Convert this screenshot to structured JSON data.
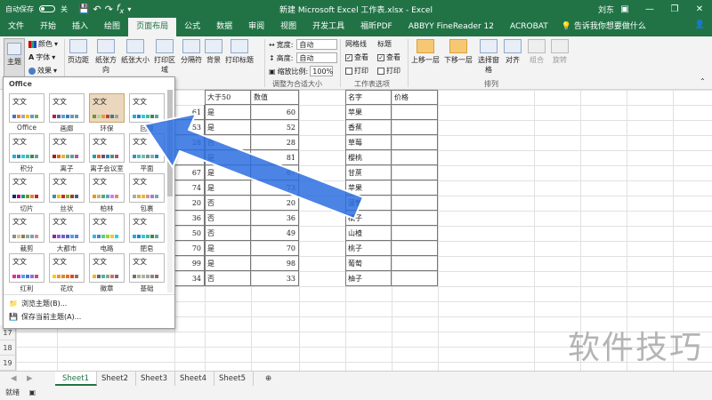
{
  "titlebar": {
    "autosave": "自动保存",
    "autosave_state": "关",
    "title": "新建 Microsoft Excel 工作表.xlsx  -  Excel",
    "user": "刘东"
  },
  "tabs": [
    "文件",
    "开始",
    "插入",
    "绘图",
    "页面布局",
    "公式",
    "数据",
    "审阅",
    "视图",
    "开发工具",
    "福昕PDF",
    "ABBYY FineReader 12",
    "ACROBAT"
  ],
  "active_tab": 4,
  "tell": "告诉我你想要做什么",
  "ribbon": {
    "theme": "主题",
    "colors": "颜色",
    "fonts": "字体",
    "effects": "效果",
    "margins": "页边距",
    "orientation": "纸张方向",
    "size": "纸张大小",
    "print_area": "打印区域",
    "breaks": "分隔符",
    "background": "背景",
    "print_titles": "打印标题",
    "width_label": "宽度:",
    "width_value": "自动",
    "height_label": "高度:",
    "height_value": "自动",
    "scale_label": "缩放比例:",
    "scale_value": "100%",
    "fit_group": "调整为合适大小",
    "gridlines": "网格线",
    "headings": "标题",
    "view": "查看",
    "print": "打印",
    "sheet_options": "工作表选项",
    "bring_forward": "上移一层",
    "send_backward": "下移一层",
    "selection_pane": "选择窗格",
    "align": "对齐",
    "group": "组合",
    "rotate": "旋转",
    "arrange": "排列"
  },
  "gallery": {
    "header": "Office",
    "themes": [
      {
        "name": "Office",
        "sample": "文文",
        "colors": [
          "#4472c4",
          "#ed7d31",
          "#a5a5a5",
          "#ffc000",
          "#5b9bd5",
          "#70ad47"
        ]
      },
      {
        "name": "画廊",
        "sample": "文文",
        "colors": [
          "#b71e42",
          "#4a66ac",
          "#629dd1",
          "#297fd5",
          "#7f8fa9",
          "#5aa2ae"
        ]
      },
      {
        "name": "环保",
        "sample": "文文",
        "colors": [
          "#6a9a1f",
          "#b5d58b",
          "#e29d3e",
          "#c03d3e",
          "#3c7c8c",
          "#a0a0a0"
        ]
      },
      {
        "name": "回顾",
        "sample": "文文",
        "colors": [
          "#1cade4",
          "#2683c6",
          "#27ced7",
          "#42ba97",
          "#3e8853",
          "#62a39f"
        ]
      },
      {
        "name": "积分",
        "sample": "文文",
        "colors": [
          "#1cade4",
          "#2683c6",
          "#27ced7",
          "#42ba97",
          "#3e8853",
          "#62a39f"
        ]
      },
      {
        "name": "离子",
        "sample": "文文",
        "colors": [
          "#b01513",
          "#ea6312",
          "#e6b729",
          "#6aac90",
          "#5f9c9d",
          "#9e5e9b"
        ]
      },
      {
        "name": "离子会议室",
        "sample": "文文",
        "colors": [
          "#0fa3b1",
          "#eb5e28",
          "#6b4e71",
          "#3e7cb1",
          "#4d9078",
          "#c04b6a"
        ]
      },
      {
        "name": "平面",
        "sample": "文文",
        "colors": [
          "#3494ba",
          "#58b6c0",
          "#75bda7",
          "#7a8c8e",
          "#84acb6",
          "#2683c6"
        ]
      },
      {
        "name": "切片",
        "sample": "文文",
        "colors": [
          "#052f61",
          "#a50e82",
          "#14967c",
          "#6a9e1f",
          "#e87d37",
          "#c62324"
        ]
      },
      {
        "name": "丝状",
        "sample": "文文",
        "colors": [
          "#3891a7",
          "#feb80a",
          "#c32d2e",
          "#84aa33",
          "#964305",
          "#475a8d"
        ]
      },
      {
        "name": "柏林",
        "sample": "文文",
        "colors": [
          "#f09415",
          "#c1b56b",
          "#4baf73",
          "#5aa6c0",
          "#d17df9",
          "#fa7e5c"
        ]
      },
      {
        "name": "包裹",
        "sample": "文文",
        "colors": [
          "#a5b592",
          "#f3a447",
          "#e7bc29",
          "#d092a7",
          "#9c85c0",
          "#809ec2"
        ]
      },
      {
        "name": "裁剪",
        "sample": "文文",
        "colors": [
          "#8c8d86",
          "#e6c069",
          "#897b61",
          "#8dab8e",
          "#77a2bb",
          "#e28394"
        ]
      },
      {
        "name": "大都市",
        "sample": "文文",
        "colors": [
          "#92278f",
          "#9b57d3",
          "#755dd9",
          "#665eb8",
          "#45a5ed",
          "#5982db"
        ]
      },
      {
        "name": "电路",
        "sample": "文文",
        "colors": [
          "#31b6fd",
          "#4584d3",
          "#5bd078",
          "#a5d028",
          "#f5c040",
          "#05e0db"
        ]
      },
      {
        "name": "肥皂",
        "sample": "文文",
        "colors": [
          "#1cade4",
          "#2683c6",
          "#27ced7",
          "#42ba97",
          "#3e8853",
          "#62a39f"
        ]
      },
      {
        "name": "红利",
        "sample": "文文",
        "colors": [
          "#e32d91",
          "#c830cc",
          "#4ea6dc",
          "#4775e7",
          "#8971e1",
          "#d54773"
        ]
      },
      {
        "name": "花纹",
        "sample": "文文",
        "colors": [
          "#ffca08",
          "#f8931d",
          "#ce8d3e",
          "#ec7016",
          "#e64823",
          "#9c6a6a"
        ]
      },
      {
        "name": "徽章",
        "sample": "文文",
        "colors": [
          "#f8b323",
          "#656a59",
          "#46b2b5",
          "#8caa7e",
          "#d36f68",
          "#826276"
        ]
      },
      {
        "name": "基础",
        "sample": "文文",
        "colors": [
          "#6f6f74",
          "#a7b789",
          "#beae98",
          "#92a9b9",
          "#9c8265",
          "#8d6974"
        ]
      }
    ],
    "browse": "浏览主题(B)...",
    "save": "保存当前主题(A)..."
  },
  "sheet": {
    "headers": [
      "大于50",
      "数值",
      "名字",
      "价格"
    ],
    "rows": [
      {
        "a": "61",
        "b": "是",
        "c": "60",
        "d": "苹果"
      },
      {
        "a": "53",
        "b": "是",
        "c": "52",
        "d": "香蕉"
      },
      {
        "a": "28",
        "b": "否",
        "c": "28",
        "d": "草莓"
      },
      {
        "a": "",
        "b": "是",
        "c": "81",
        "d": "樱桃"
      },
      {
        "a": "67",
        "b": "是",
        "c": "67",
        "d": "甘蔗"
      },
      {
        "a": "74",
        "b": "是",
        "c": "73",
        "d": "苹果"
      },
      {
        "a": "20",
        "b": "否",
        "c": "20",
        "d": "菠萝"
      },
      {
        "a": "36",
        "b": "否",
        "c": "36",
        "d": "橘子"
      },
      {
        "a": "50",
        "b": "否",
        "c": "49",
        "d": "山楂"
      },
      {
        "a": "70",
        "b": "是",
        "c": "70",
        "d": "桃子"
      },
      {
        "a": "99",
        "b": "是",
        "c": "98",
        "d": "葡萄"
      },
      {
        "a": "34",
        "b": "否",
        "c": "33",
        "d": "柚子"
      }
    ],
    "row_numbers": [
      "17",
      "18",
      "19"
    ]
  },
  "sheet_tabs": [
    "Sheet1",
    "Sheet2",
    "Sheet3",
    "Sheet4",
    "Sheet5"
  ],
  "status": "就绪",
  "watermark": "软件技巧",
  "colors": {
    "excel_green": "#217346",
    "arrow_blue": "#2b6fe0"
  }
}
